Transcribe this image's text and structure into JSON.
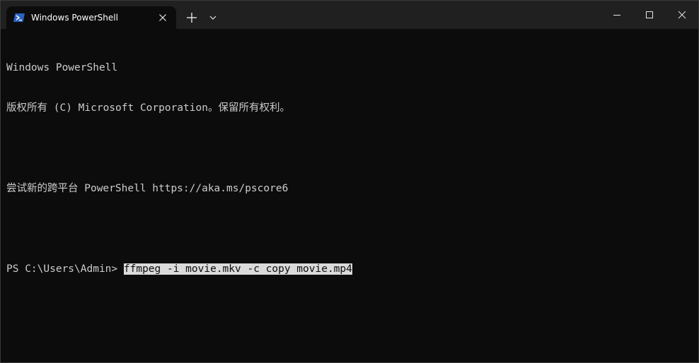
{
  "window": {
    "tab_title": "Windows PowerShell",
    "tab_icon": "powershell-icon",
    "new_tab_icon": "plus-icon",
    "dropdown_icon": "chevron-down-icon",
    "caption_buttons": [
      "minimize-icon",
      "maximize-icon",
      "close-icon"
    ]
  },
  "terminal": {
    "lines": [
      "Windows PowerShell",
      "版权所有 (C) Microsoft Corporation。保留所有权利。",
      "",
      "尝试新的跨平台 PowerShell https://aka.ms/pscore6",
      ""
    ],
    "prompt": "PS C:\\Users\\Admin> ",
    "command": "ffmpeg -i movie.mkv -c copy movie.mp4"
  },
  "colors": {
    "background": "#0c0c0c",
    "titlebar": "#202020",
    "foreground": "#cccccc",
    "selection": "#dadada"
  }
}
